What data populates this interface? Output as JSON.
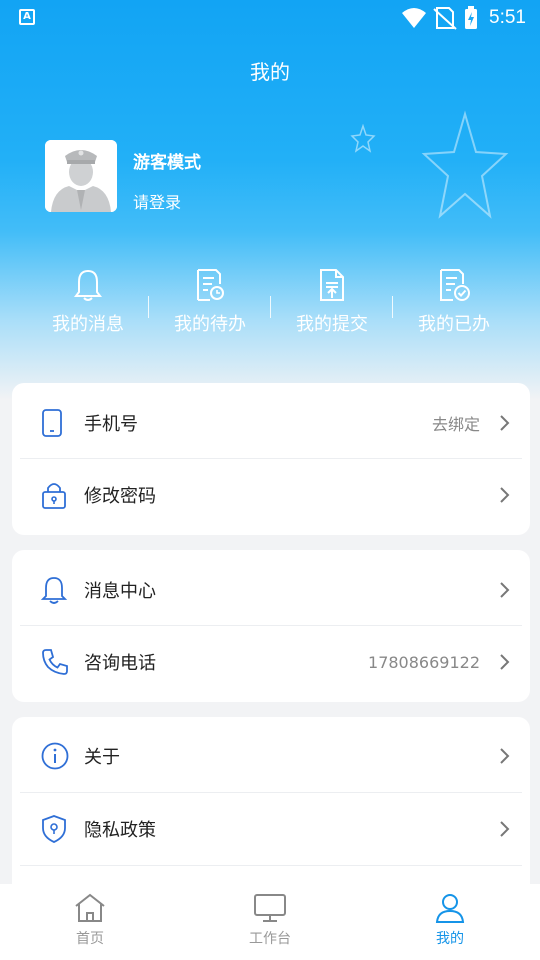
{
  "status_bar": {
    "app_badge": "A",
    "time": "5:51"
  },
  "header": {
    "title": "我的"
  },
  "user": {
    "name": "游客模式",
    "subtitle": "请登录"
  },
  "quick_actions": [
    {
      "label": "我的消息",
      "icon": "bell-icon"
    },
    {
      "label": "我的待办",
      "icon": "todo-icon"
    },
    {
      "label": "我的提交",
      "icon": "submit-icon"
    },
    {
      "label": "我的已办",
      "icon": "done-icon"
    }
  ],
  "settings": {
    "phone": {
      "label": "手机号",
      "value": "去绑定",
      "icon": "phone-icon"
    },
    "password": {
      "label": "修改密码",
      "icon": "lock-icon"
    },
    "messages": {
      "label": "消息中心",
      "icon": "bell-icon"
    },
    "hotline": {
      "label": "咨询电话",
      "value": "17808669122",
      "icon": "telephone-icon"
    },
    "about": {
      "label": "关于",
      "icon": "info-icon"
    },
    "privacy": {
      "label": "隐私政策",
      "icon": "shield-icon"
    }
  },
  "tabbar": {
    "items": [
      {
        "label": "首页",
        "icon": "home-icon",
        "active": false
      },
      {
        "label": "工作台",
        "icon": "monitor-icon",
        "active": false
      },
      {
        "label": "我的",
        "icon": "user-icon",
        "active": true
      }
    ]
  },
  "colors": {
    "primary": "#1594e8",
    "header_top": "#12a4f4",
    "icon_blue": "#2f6fd6"
  }
}
